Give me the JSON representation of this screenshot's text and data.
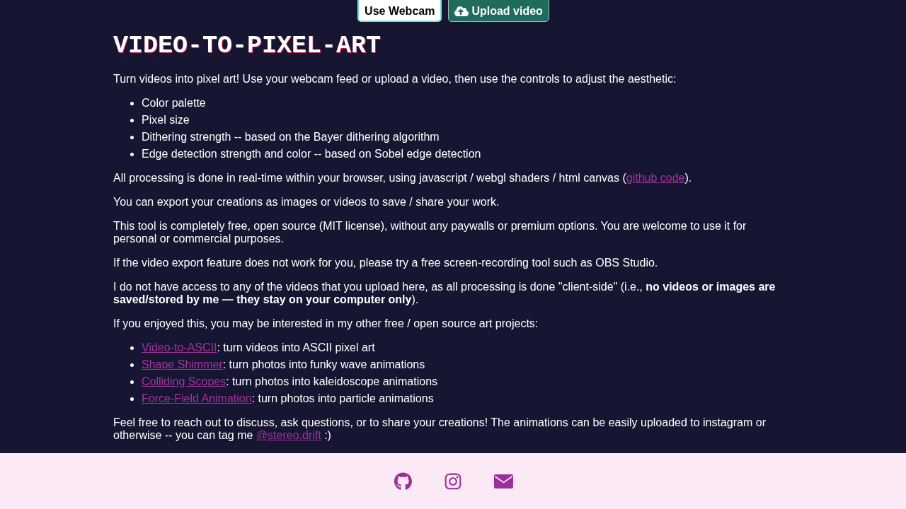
{
  "header_buttons": [
    {
      "kind": "plain",
      "label": "Use Webcam"
    },
    {
      "kind": "upload",
      "label": "Upload video"
    }
  ],
  "title": "VIDEO-TO-PIXEL-ART",
  "blocks": [
    {
      "kind": "paragraph",
      "parts": [
        {
          "kind": "text",
          "text": "Turn videos into pixel art! Use your webcam feed or upload a video, then use the controls to adjust the aesthetic:"
        }
      ]
    },
    {
      "kind": "list",
      "items": [
        {
          "parts": [
            {
              "kind": "text",
              "text": "Color palette"
            }
          ]
        },
        {
          "parts": [
            {
              "kind": "text",
              "text": "Pixel size"
            }
          ]
        },
        {
          "parts": [
            {
              "kind": "text",
              "text": "Dithering strength -- based on the Bayer dithering algorithm"
            }
          ]
        },
        {
          "parts": [
            {
              "kind": "text",
              "text": "Edge detection strength and color -- based on Sobel edge detection"
            }
          ]
        }
      ]
    },
    {
      "kind": "paragraph",
      "parts": [
        {
          "kind": "text",
          "text": "All processing is done in real-time within your browser, using javascript / webgl shaders / html canvas ("
        },
        {
          "kind": "link",
          "text": "github code"
        },
        {
          "kind": "text",
          "text": ")."
        }
      ]
    },
    {
      "kind": "paragraph",
      "parts": [
        {
          "kind": "text",
          "text": "You can export your creations as images or videos to save / share your work."
        }
      ]
    },
    {
      "kind": "paragraph",
      "parts": [
        {
          "kind": "text",
          "text": "This tool is completely free, open source (MIT license), without any paywalls or premium options. You are welcome to use it for personal or commercial purposes."
        }
      ]
    },
    {
      "kind": "paragraph",
      "parts": [
        {
          "kind": "text",
          "text": "If the video export feature does not work for you, please try a free screen-recording tool such as OBS Studio."
        }
      ]
    },
    {
      "kind": "paragraph",
      "parts": [
        {
          "kind": "text",
          "text": "I do not have access to any of the videos that you upload here, as all processing is done \"client-side\" (i.e., **no videos or images are saved/stored by me — they stay on your computer only**)."
        }
      ]
    },
    {
      "kind": "paragraph",
      "parts": [
        {
          "kind": "text",
          "text": "If you enjoyed this, you may be interested in my other free / open source art projects:"
        }
      ]
    },
    {
      "kind": "list",
      "items": [
        {
          "parts": [
            {
              "kind": "link",
              "text": "Video-to-ASCII"
            },
            {
              "kind": "text",
              "text": ": turn videos into ASCII pixel art"
            }
          ]
        },
        {
          "parts": [
            {
              "kind": "link",
              "text": "Shape Shimmer"
            },
            {
              "kind": "text",
              "text": ": turn photos into funky wave animations"
            }
          ]
        },
        {
          "parts": [
            {
              "kind": "link",
              "text": "Colliding Scopes"
            },
            {
              "kind": "text",
              "text": ": turn photos into kaleidoscope animations"
            }
          ]
        },
        {
          "parts": [
            {
              "kind": "link",
              "text": "Force-Field Animation"
            },
            {
              "kind": "text",
              "text": ": turn photos into particle animations"
            }
          ]
        }
      ]
    },
    {
      "kind": "paragraph",
      "parts": [
        {
          "kind": "text",
          "text": "Feel free to reach out to discuss, ask questions, or to share your creations! The animations can be easily uploaded to instagram or otherwise -- you can tag me "
        },
        {
          "kind": "link",
          "text": "@stereo.drift"
        },
        {
          "kind": "text",
          "text": " :)"
        }
      ]
    }
  ]
}
